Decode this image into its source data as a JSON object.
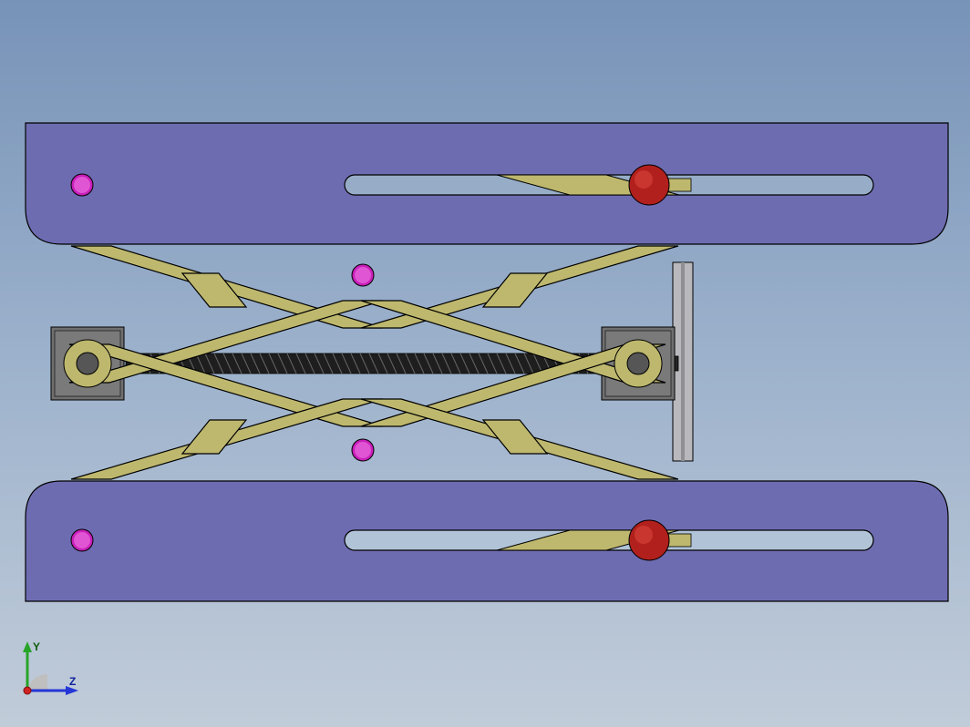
{
  "view": {
    "triad": {
      "y_label": "Y",
      "z_label": "Z",
      "x_label": ""
    }
  },
  "model": {
    "description": "Scissor jack / lab lift mechanism assembly",
    "top_plate": {
      "color": "#6E6CB1",
      "outline": "#000000"
    },
    "bottom_plate": {
      "color": "#6E6CB1",
      "outline": "#000000"
    },
    "scissor_arms": {
      "color": "#BEB86E",
      "outline": "#000000"
    },
    "lead_screw": {
      "color": "#303030"
    },
    "pivot_pins_magenta": {
      "color": "#C81FB9"
    },
    "pivot_balls_red": {
      "color": "#B2201D"
    },
    "hinge_blocks": {
      "color": "#6F6F6F"
    },
    "handwheel": {
      "color": "#8D8D8D"
    }
  }
}
